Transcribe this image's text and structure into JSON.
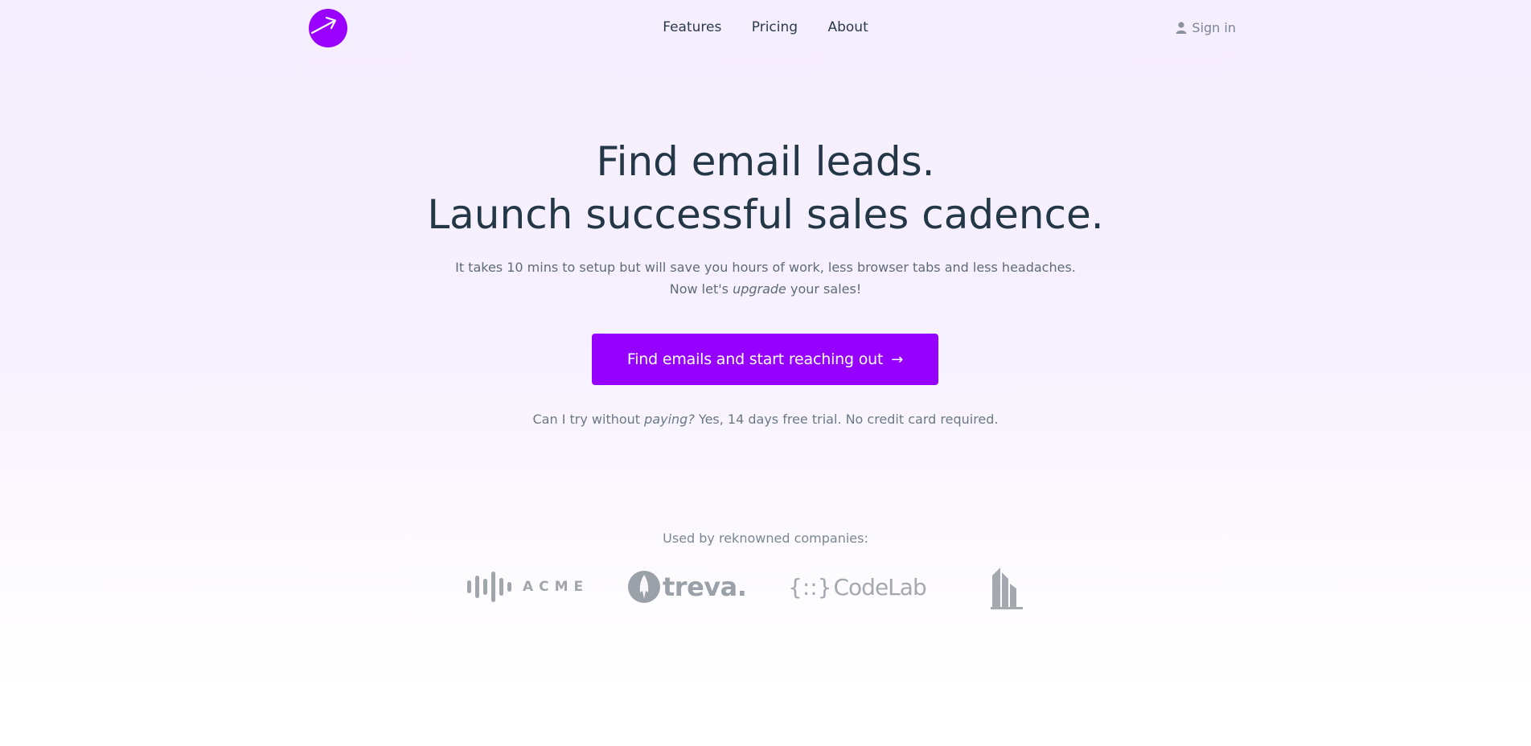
{
  "nav": {
    "links": [
      {
        "label": "Features"
      },
      {
        "label": "Pricing"
      },
      {
        "label": "About"
      }
    ],
    "signin_label": "Sign in"
  },
  "hero": {
    "title_line1": "Find email leads.",
    "title_line2": "Launch successful sales cadence.",
    "subtitle_line1": "It takes 10 mins to setup but will save you hours of work, less browser tabs and less headaches.",
    "subtitle_line2_prefix": "Now let's ",
    "subtitle_line2_emph": "upgrade",
    "subtitle_line2_suffix": " your sales!",
    "cta_label": "Find emails and start reaching out",
    "cta_arrow": "→",
    "trial_prefix": "Can I try without ",
    "trial_emph": "paying?",
    "trial_suffix": " Yes, 14 days free trial. No credit card required."
  },
  "companies": {
    "heading": "Used by reknowned companies:",
    "logos": [
      {
        "name": "ACME",
        "icon": "sound-bars-icon"
      },
      {
        "name": "treva.",
        "icon": "rocket-circle-icon"
      },
      {
        "name_brace": "{::}",
        "name": "CodeLab",
        "icon": "code-brace-icon"
      },
      {
        "name": "",
        "icon": "building-icon"
      }
    ]
  },
  "colors": {
    "accent": "#9500ff",
    "text_dark": "#243746",
    "text_muted": "#6b7886",
    "logo_gray": "#9aa1a8"
  }
}
